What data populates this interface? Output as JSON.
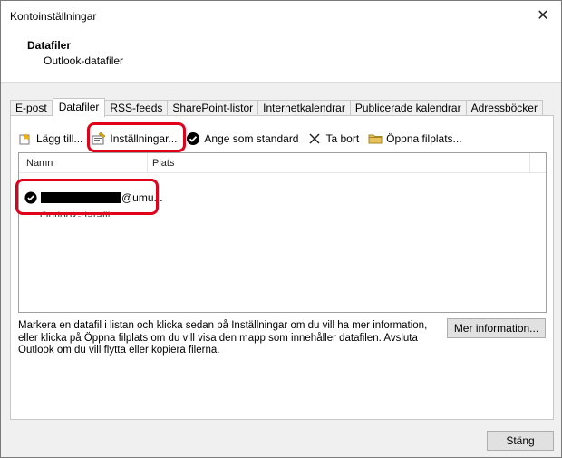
{
  "window": {
    "title": "Kontoinställningar",
    "close_glyph": "✕"
  },
  "header": {
    "title": "Datafiler",
    "subtitle": "Outlook-datafiler"
  },
  "tabs": [
    {
      "label": "E-post",
      "active": false
    },
    {
      "label": "Datafiler",
      "active": true
    },
    {
      "label": "RSS-feeds",
      "active": false
    },
    {
      "label": "SharePoint-listor",
      "active": false
    },
    {
      "label": "Internetkalendrar",
      "active": false
    },
    {
      "label": "Publicerade kalendrar",
      "active": false
    },
    {
      "label": "Adressböcker",
      "active": false
    }
  ],
  "toolbar": {
    "add_label": "Lägg till...",
    "settings_label": "Inställningar...",
    "default_label": "Ange som standard",
    "remove_label": "Ta bort",
    "open_location_label": "Öppna filplats..."
  },
  "list": {
    "columns": [
      "Namn",
      "Plats"
    ],
    "rows": [
      {
        "name_suffix": "@umu...",
        "subtitle": "Outlook-datafil",
        "is_default": true
      }
    ]
  },
  "info_text": "Markera en datafil i listan och klicka sedan på Inställningar om du vill ha mer information, eller klicka på Öppna filplats om du vill visa den mapp som innehåller datafilen. Avsluta Outlook om du vill flytta eller kopiera filerna.",
  "more_info_label": "Mer information...",
  "close_button_label": "Stäng",
  "colors": {
    "highlight": "#e0001a",
    "accent_check": "#000000"
  }
}
